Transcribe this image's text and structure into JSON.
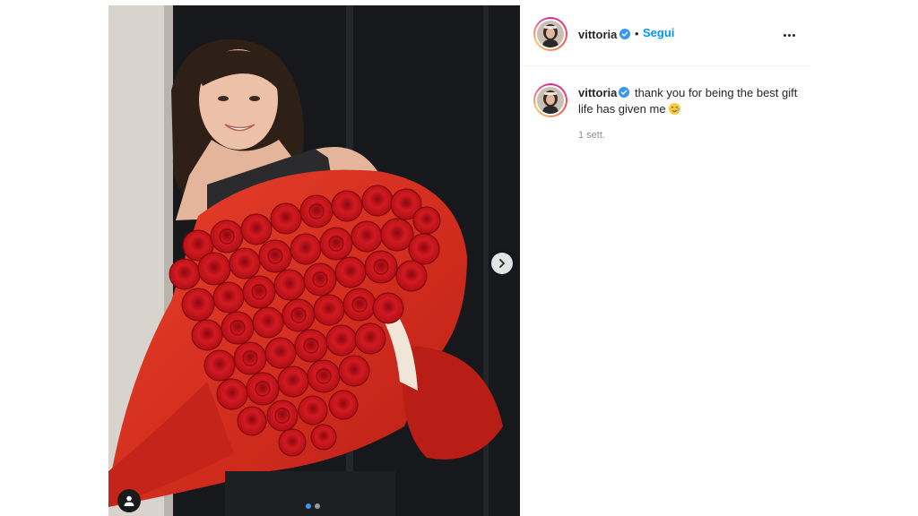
{
  "post": {
    "username": "vittoria",
    "verified": true,
    "follow_label": "Segui",
    "caption_user": "vittoria",
    "caption_text": "thank you for being the best gift life has given me",
    "caption_emoji": "smiling-face-with-tear-emoji",
    "timestamp": "1 sett.",
    "carousel_count": 2,
    "carousel_index": 1
  },
  "colors": {
    "follow": "#0095f6",
    "verified_badge": "#3897f0",
    "roses": "#c4121a",
    "wrapping_paper": "#d7301f",
    "background": "#ffffff"
  },
  "icons": {
    "next": "chevron-right-icon",
    "tagged_users": "user-icon",
    "more": "more-horizontal-icon",
    "verified": "verified-badge-icon"
  }
}
